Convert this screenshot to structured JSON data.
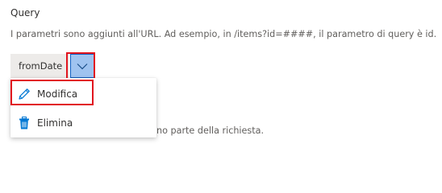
{
  "section": {
    "title": "Query",
    "description": "I parametri sono aggiunti all'URL. Ad esempio, in /items?id=####, il parametro di query è id."
  },
  "parameter": {
    "name": "fromDate",
    "dropdown_icon": "chevron-down-icon"
  },
  "menu": {
    "items": [
      {
        "label": "Modifica",
        "icon": "pencil-icon"
      },
      {
        "label": "Elimina",
        "icon": "trash-icon"
      }
    ]
  },
  "footer": {
    "partial_text": "no parte della richiesta."
  },
  "colors": {
    "accent": "#0078d4",
    "highlight": "#e1141e",
    "chevron_button_bg": "#9fc3f0"
  }
}
